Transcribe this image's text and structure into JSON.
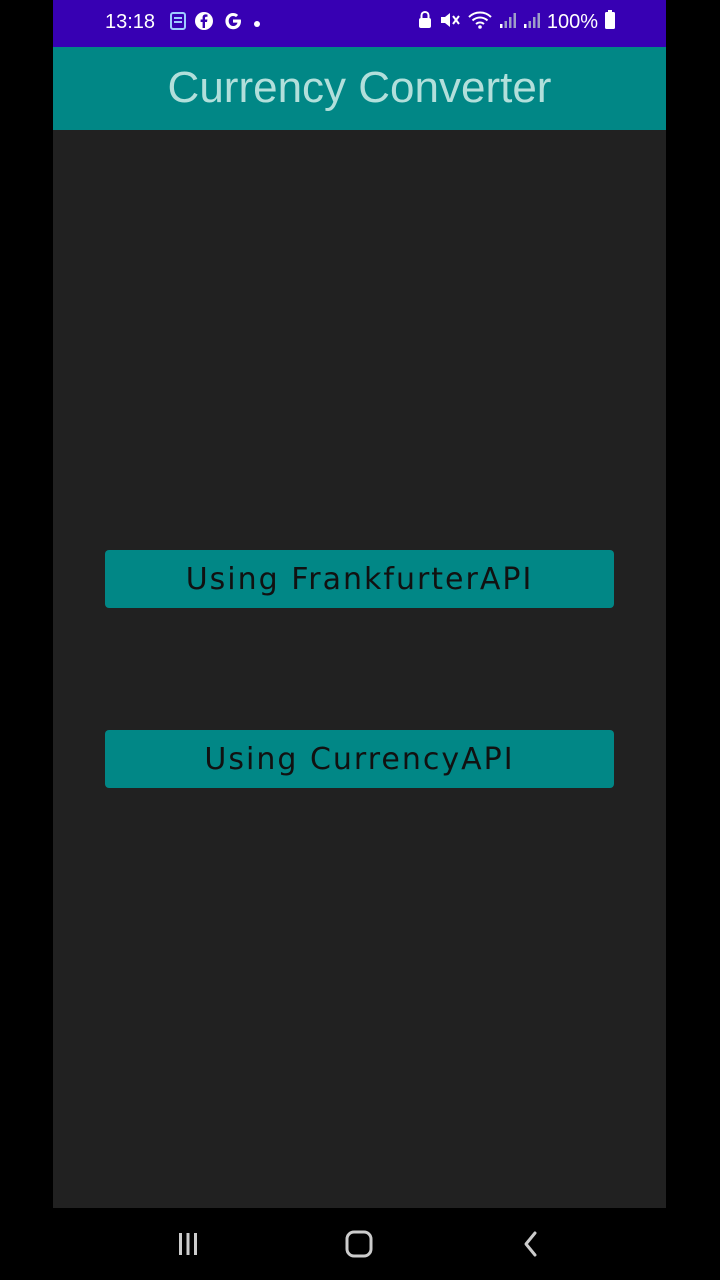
{
  "status_bar": {
    "time": "13:18",
    "left_icons": [
      "notification-icon",
      "facebook-icon",
      "google-icon",
      "dot-icon"
    ],
    "right_icons": [
      "lock-icon",
      "mute-icon",
      "wifi-icon",
      "signal-icon",
      "signal-icon",
      "battery-icon"
    ],
    "battery": "100%"
  },
  "app_bar": {
    "title": "Currency Converter"
  },
  "buttons": {
    "frankfurter": "Using FrankfurterAPI",
    "currency": "Using CurrencyAPI"
  },
  "nav_bar": {
    "items": [
      "recents-icon",
      "home-icon",
      "back-icon"
    ]
  },
  "colors": {
    "status_bar": "#3700b3",
    "primary": "#018786",
    "title_text": "#b2dfdb",
    "background": "#212121"
  }
}
